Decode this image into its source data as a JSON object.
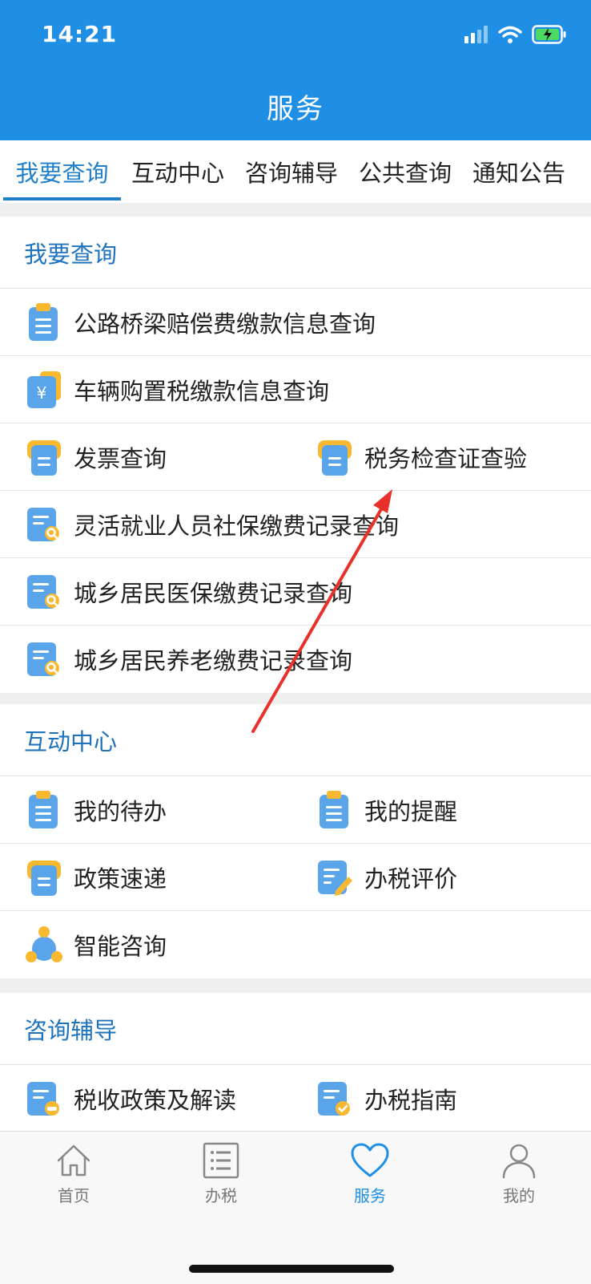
{
  "status_bar": {
    "time": "14:21"
  },
  "header": {
    "title": "服务"
  },
  "tabs": [
    {
      "label": "我要查询",
      "active": true
    },
    {
      "label": "互动中心"
    },
    {
      "label": "咨询辅导"
    },
    {
      "label": "公共查询"
    },
    {
      "label": "通知公告"
    }
  ],
  "sections": {
    "query": {
      "title": "我要查询",
      "items": [
        {
          "label": "公路桥梁赔偿费缴款信息查询",
          "icon": "clipboard-icon"
        },
        {
          "label": "车辆购置税缴款信息查询",
          "icon": "yuan-doc-icon"
        },
        {
          "label": "发票查询",
          "icon": "folder-doc-icon"
        },
        {
          "label": "税务检查证查验",
          "icon": "folder-doc-icon"
        },
        {
          "label": "灵活就业人员社保缴费记录查询",
          "icon": "doc-search-icon"
        },
        {
          "label": "城乡居民医保缴费记录查询",
          "icon": "doc-search-icon"
        },
        {
          "label": "城乡居民养老缴费记录查询",
          "icon": "doc-search-icon"
        }
      ]
    },
    "interact": {
      "title": "互动中心",
      "items": [
        {
          "label": "我的待办",
          "icon": "clipboard-icon"
        },
        {
          "label": "我的提醒",
          "icon": "clipboard-icon"
        },
        {
          "label": "政策速递",
          "icon": "folder-doc-icon"
        },
        {
          "label": "办税评价",
          "icon": "doc-edit-icon"
        },
        {
          "label": "智能咨询",
          "icon": "network-icon"
        }
      ]
    },
    "consult": {
      "title": "咨询辅导",
      "items": [
        {
          "label": "税收政策及解读",
          "icon": "doc-car-icon"
        },
        {
          "label": "办税指南",
          "icon": "doc-check-icon"
        }
      ]
    }
  },
  "bottom_nav": [
    {
      "label": "首页",
      "icon": "home-icon"
    },
    {
      "label": "办税",
      "icon": "list-icon"
    },
    {
      "label": "服务",
      "icon": "heart-icon",
      "active": true
    },
    {
      "label": "我的",
      "icon": "user-icon"
    }
  ],
  "colors": {
    "primary": "#1f8fe6",
    "section_title": "#1f73bd",
    "icon_blue": "#5aa5ea",
    "icon_yellow": "#f8b930",
    "arrow": "#e8312a"
  }
}
